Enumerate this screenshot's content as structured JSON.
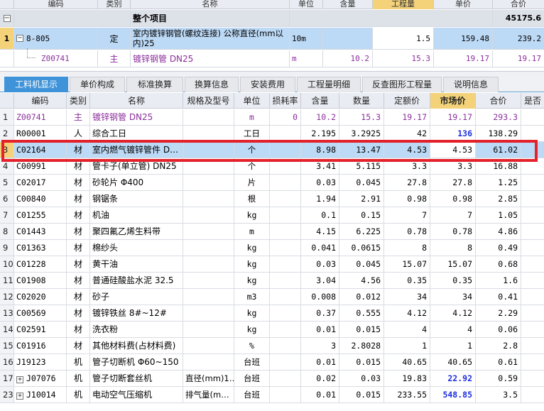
{
  "top": {
    "headers": [
      "编码",
      "类别",
      "名称",
      "单位",
      "含量",
      "工程量",
      "单价",
      "合价"
    ],
    "summary": {
      "collapse": "−",
      "name": "整个项目",
      "total": "45175.6"
    },
    "item": {
      "rowno": "1",
      "toggle": "−",
      "code": "8-805",
      "type": "定",
      "name_line1": "室内镀锌钢管(螺纹连接) 公称直径(mm以",
      "name_line2": "内)25",
      "unit": "10m",
      "quantity": "1.5",
      "price": "159.48",
      "total": "239.2"
    },
    "sub": {
      "code": "Z00741",
      "type": "主",
      "name": "镀锌钢管 DN25",
      "unit": "m",
      "content": "10.2",
      "quantity": "15.3",
      "price": "19.17",
      "total": "19.17"
    }
  },
  "tabs": [
    "工料机显示",
    "单价构成",
    "标准换算",
    "换算信息",
    "安装费用",
    "工程量明细",
    "反查图形工程量",
    "说明信息"
  ],
  "grid": {
    "headers": [
      "编码",
      "类别",
      "名称",
      "规格及型号",
      "单位",
      "损耗率",
      "含量",
      "数量",
      "定额价",
      "市场价",
      "合价",
      "是否"
    ],
    "rows": [
      {
        "no": "1",
        "code": "Z00741",
        "type": "主",
        "name": "镀锌钢管 DN25",
        "spec": "",
        "unit": "m",
        "loss": "0",
        "content": "10.2",
        "qty": "15.3",
        "base": "19.17",
        "market": "19.17",
        "total": "293.3"
      },
      {
        "no": "2",
        "code": "R00001",
        "type": "人",
        "name": "综合工日",
        "spec": "",
        "unit": "工日",
        "loss": "",
        "content": "2.195",
        "qty": "3.2925",
        "base": "42",
        "market": "136",
        "total": "138.29"
      },
      {
        "no": "3",
        "code": "C02164",
        "type": "材",
        "name": "室内燃气镀锌管件 D…",
        "spec": "",
        "unit": "个",
        "loss": "",
        "content": "8.98",
        "qty": "13.47",
        "base": "4.53",
        "market": "4.53",
        "total": "61.02"
      },
      {
        "no": "4",
        "code": "C00991",
        "type": "材",
        "name": "管卡子(单立管) DN25",
        "spec": "",
        "unit": "个",
        "loss": "",
        "content": "3.41",
        "qty": "5.115",
        "base": "3.3",
        "market": "3.3",
        "total": "16.88"
      },
      {
        "no": "5",
        "code": "C02017",
        "type": "材",
        "name": "砂轮片 Φ400",
        "spec": "",
        "unit": "片",
        "loss": "",
        "content": "0.03",
        "qty": "0.045",
        "base": "27.8",
        "market": "27.8",
        "total": "1.25"
      },
      {
        "no": "6",
        "code": "C00840",
        "type": "材",
        "name": "钢锯条",
        "spec": "",
        "unit": "根",
        "loss": "",
        "content": "1.94",
        "qty": "2.91",
        "base": "0.98",
        "market": "0.98",
        "total": "2.85"
      },
      {
        "no": "7",
        "code": "C01255",
        "type": "材",
        "name": "机油",
        "spec": "",
        "unit": "kg",
        "loss": "",
        "content": "0.1",
        "qty": "0.15",
        "base": "7",
        "market": "7",
        "total": "1.05"
      },
      {
        "no": "8",
        "code": "C01443",
        "type": "材",
        "name": "聚四氟乙烯生料带",
        "spec": "",
        "unit": "m",
        "loss": "",
        "content": "4.15",
        "qty": "6.225",
        "base": "0.78",
        "market": "0.78",
        "total": "4.86"
      },
      {
        "no": "9",
        "code": "C01363",
        "type": "材",
        "name": "棉纱头",
        "spec": "",
        "unit": "kg",
        "loss": "",
        "content": "0.041",
        "qty": "0.0615",
        "base": "8",
        "market": "8",
        "total": "0.49"
      },
      {
        "no": "10",
        "code": "C01228",
        "type": "材",
        "name": "黄干油",
        "spec": "",
        "unit": "kg",
        "loss": "",
        "content": "0.03",
        "qty": "0.045",
        "base": "15.07",
        "market": "15.07",
        "total": "0.68"
      },
      {
        "no": "11",
        "code": "C01908",
        "type": "材",
        "name": "普通硅酸盐水泥 32.5",
        "spec": "",
        "unit": "kg",
        "loss": "",
        "content": "3.04",
        "qty": "4.56",
        "base": "0.35",
        "market": "0.35",
        "total": "1.6"
      },
      {
        "no": "12",
        "code": "C02020",
        "type": "材",
        "name": "砂子",
        "spec": "",
        "unit": "m3",
        "loss": "",
        "content": "0.008",
        "qty": "0.012",
        "base": "34",
        "market": "34",
        "total": "0.41"
      },
      {
        "no": "13",
        "code": "C00569",
        "type": "材",
        "name": "镀锌铁丝 8#~12#",
        "spec": "",
        "unit": "kg",
        "loss": "",
        "content": "0.37",
        "qty": "0.555",
        "base": "4.12",
        "market": "4.12",
        "total": "2.29"
      },
      {
        "no": "14",
        "code": "C02591",
        "type": "材",
        "name": "洗衣粉",
        "spec": "",
        "unit": "kg",
        "loss": "",
        "content": "0.01",
        "qty": "0.015",
        "base": "4",
        "market": "4",
        "total": "0.06"
      },
      {
        "no": "15",
        "code": "C01916",
        "type": "材",
        "name": "其他材料费(占材料费)",
        "spec": "",
        "unit": "%",
        "loss": "",
        "content": "3",
        "qty": "2.8028",
        "base": "1",
        "market": "1",
        "total": "2.8"
      },
      {
        "no": "16",
        "code": "J19123",
        "type": "机",
        "name": "管子切断机 Φ60~150",
        "spec": "",
        "unit": "台班",
        "loss": "",
        "content": "0.01",
        "qty": "0.015",
        "base": "40.65",
        "market": "40.65",
        "total": "0.61"
      },
      {
        "no": "17",
        "code": "J07076",
        "type": "机",
        "name": "管子切断套丝机",
        "spec": "直径(mm)1…",
        "unit": "台班",
        "loss": "",
        "content": "0.02",
        "qty": "0.03",
        "base": "19.83",
        "market": "22.92",
        "total": "0.59"
      },
      {
        "no": "23",
        "code": "J10014",
        "type": "机",
        "name": "电动空气压缩机",
        "spec": "排气量(m…",
        "unit": "台班",
        "loss": "",
        "content": "0.01",
        "qty": "0.015",
        "base": "233.55",
        "market": "548.85",
        "total": "3.5"
      }
    ]
  }
}
